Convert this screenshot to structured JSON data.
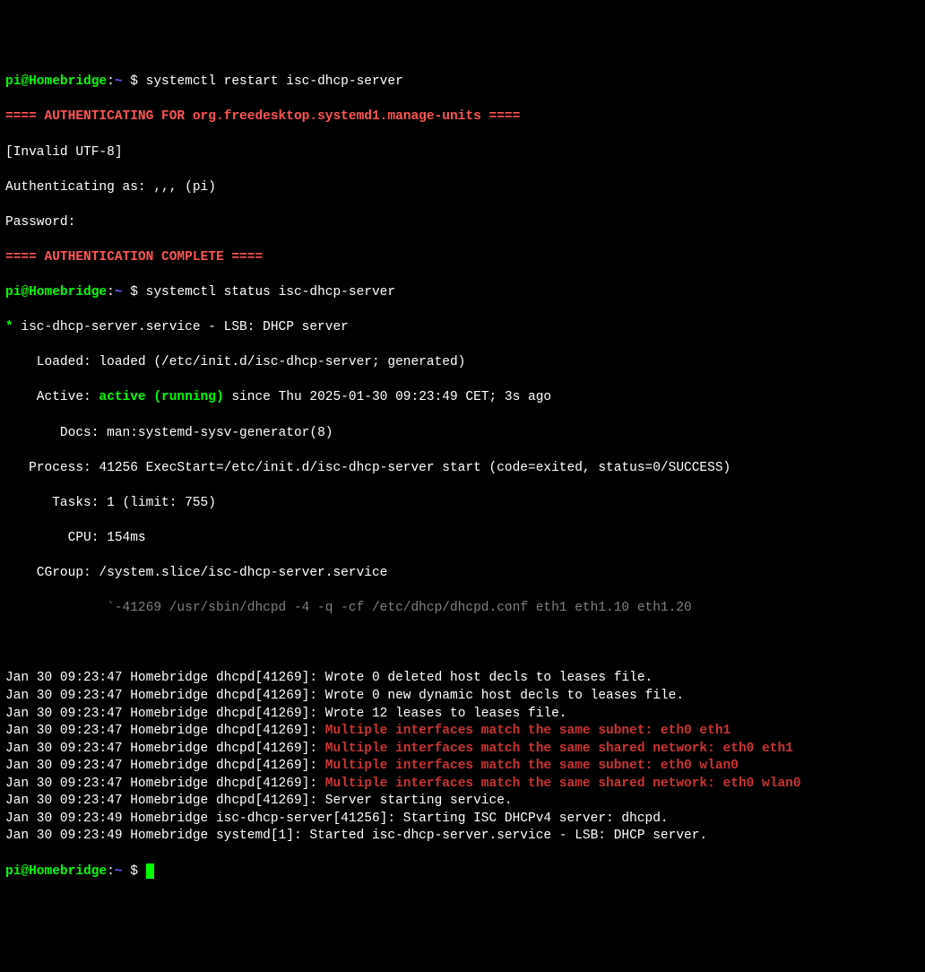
{
  "prompt": {
    "user": "pi",
    "at": "@",
    "host": "Homebridge",
    "colon": ":",
    "path": "~ ",
    "dollar": "$ "
  },
  "cmd1": "systemctl restart isc-dhcp-server",
  "auth_header": "==== AUTHENTICATING FOR org.freedesktop.systemd1.manage-units ====",
  "invalid_utf8": "[Invalid UTF-8]",
  "auth_as": "Authenticating as: ,,, (pi)",
  "password": "Password:",
  "auth_complete": "==== AUTHENTICATION COMPLETE ====",
  "cmd2": "systemctl status isc-dhcp-server",
  "status": {
    "bullet": "* ",
    "unit": "isc-dhcp-server.service - LSB: DHCP server",
    "loaded_label": "    Loaded: ",
    "loaded_value": "loaded (/etc/init.d/isc-dhcp-server; generated)",
    "active_label": "    Active: ",
    "active_status": "active (running)",
    "active_since": " since Thu 2025-01-30 09:23:49 CET; 3s ago",
    "docs_label": "       Docs: ",
    "docs_value": "man:systemd-sysv-generator(8)",
    "process_label": "   Process: ",
    "process_value": "41256 ExecStart=/etc/init.d/isc-dhcp-server start (code=exited, status=0/SUCCESS)",
    "tasks_label": "      Tasks: ",
    "tasks_value": "1 (limit: 755)",
    "cpu_label": "        CPU: ",
    "cpu_value": "154ms",
    "cgroup_label": "    CGroup: ",
    "cgroup_value": "/system.slice/isc-dhcp-server.service",
    "cgroup_tree": "             `-41269 /usr/sbin/dhcpd -4 -q -cf /etc/dhcp/dhcpd.conf eth1 eth1.10 eth1.20"
  },
  "logs": [
    {
      "ts": "Jan 30 09:23:47 Homebridge dhcpd[41269]: ",
      "msg": "Wrote 0 deleted host decls to leases file.",
      "warn": false
    },
    {
      "ts": "Jan 30 09:23:47 Homebridge dhcpd[41269]: ",
      "msg": "Wrote 0 new dynamic host decls to leases file.",
      "warn": false
    },
    {
      "ts": "Jan 30 09:23:47 Homebridge dhcpd[41269]: ",
      "msg": "Wrote 12 leases to leases file.",
      "warn": false
    },
    {
      "ts": "Jan 30 09:23:47 Homebridge dhcpd[41269]: ",
      "msg": "Multiple interfaces match the same subnet: eth0 eth1",
      "warn": true
    },
    {
      "ts": "Jan 30 09:23:47 Homebridge dhcpd[41269]: ",
      "msg": "Multiple interfaces match the same shared network: eth0 eth1",
      "warn": true
    },
    {
      "ts": "Jan 30 09:23:47 Homebridge dhcpd[41269]: ",
      "msg": "Multiple interfaces match the same subnet: eth0 wlan0",
      "warn": true
    },
    {
      "ts": "Jan 30 09:23:47 Homebridge dhcpd[41269]: ",
      "msg": "Multiple interfaces match the same shared network: eth0 wlan0",
      "warn": true
    },
    {
      "ts": "Jan 30 09:23:47 Homebridge dhcpd[41269]: ",
      "msg": "Server starting service.",
      "warn": false
    },
    {
      "ts": "Jan 30 09:23:49 Homebridge isc-dhcp-server[41256]: ",
      "msg": "Starting ISC DHCPv4 server: dhcpd.",
      "warn": false
    },
    {
      "ts": "Jan 30 09:23:49 Homebridge systemd[1]: ",
      "msg": "Started isc-dhcp-server.service - LSB: DHCP server.",
      "warn": false
    }
  ],
  "blank": " "
}
